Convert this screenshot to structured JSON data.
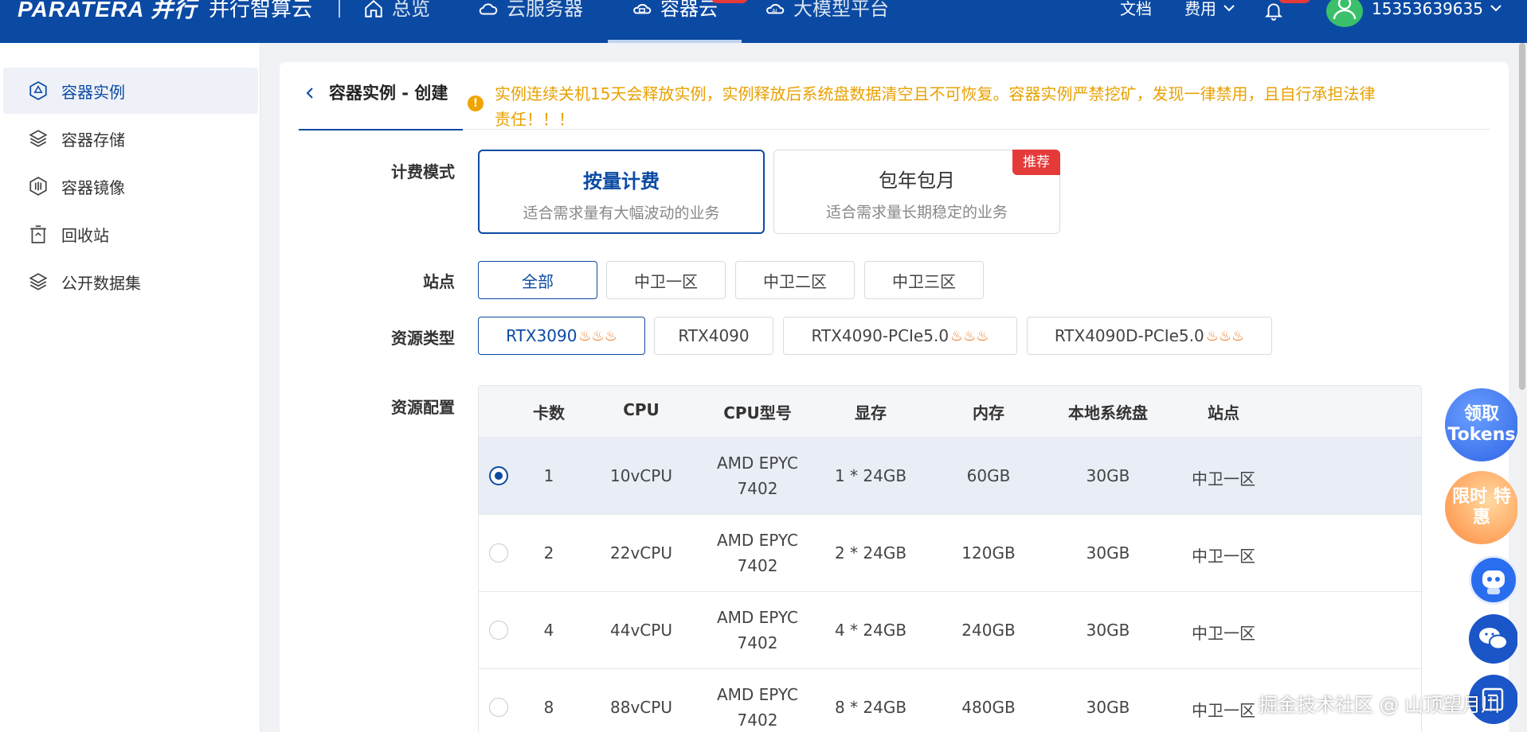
{
  "header": {
    "logo": "PARATERA 并行",
    "brand": "并行智算云",
    "nav": [
      {
        "label": "总览",
        "icon": "home-icon"
      },
      {
        "label": "云服务器",
        "icon": "cloud-icon"
      },
      {
        "label": "容器云",
        "icon": "container-icon",
        "active": true
      },
      {
        "label": "大模型平台",
        "icon": "ai-cloud-icon"
      }
    ],
    "docs": "文档",
    "fees": "费用",
    "user": "15353639635"
  },
  "sidebar": {
    "items": [
      {
        "label": "容器实例",
        "icon": "instance-icon",
        "active": true
      },
      {
        "label": "容器存储",
        "icon": "storage-icon"
      },
      {
        "label": "容器镜像",
        "icon": "image-icon"
      },
      {
        "label": "回收站",
        "icon": "trash-icon"
      },
      {
        "label": "公开数据集",
        "icon": "dataset-icon"
      }
    ]
  },
  "page": {
    "title": "容器实例 - 创建",
    "warning": "实例连续关机15天会释放实例，实例释放后系统盘数据清空且不可恢复。容器实例严禁挖矿，发现一律禁用，且自行承担法律责任！！！"
  },
  "billing": {
    "label": "计费模式",
    "options": [
      {
        "title": "按量计费",
        "desc": "适合需求量有大幅波动的业务",
        "selected": true
      },
      {
        "title": "包年包月",
        "desc": "适合需求量长期稳定的业务",
        "tag": "推荐"
      }
    ]
  },
  "site": {
    "label": "站点",
    "options": [
      "全部",
      "中卫一区",
      "中卫二区",
      "中卫三区"
    ],
    "selected": "全部"
  },
  "resource_type": {
    "label": "资源类型",
    "options": [
      "RTX3090",
      "RTX4090",
      "RTX4090-PCIe5.0",
      "RTX4090D-PCIe5.0"
    ],
    "selected": "RTX3090",
    "fire_icon": "flame-icon"
  },
  "resource_config": {
    "label": "资源配置",
    "columns": [
      "卡数",
      "CPU",
      "CPU型号",
      "显存",
      "内存",
      "本地系统盘",
      "站点"
    ],
    "rows": [
      {
        "cards": "1",
        "cpu": "10vCPU",
        "model_l1": "AMD EPYC",
        "model_l2": "7402",
        "vram": "1 * 24GB",
        "mem": "60GB",
        "disk": "30GB",
        "site": "中卫一区",
        "selected": true
      },
      {
        "cards": "2",
        "cpu": "22vCPU",
        "model_l1": "AMD EPYC",
        "model_l2": "7402",
        "vram": "2 * 24GB",
        "mem": "120GB",
        "disk": "30GB",
        "site": "中卫一区"
      },
      {
        "cards": "4",
        "cpu": "44vCPU",
        "model_l1": "AMD EPYC",
        "model_l2": "7402",
        "vram": "4 * 24GB",
        "mem": "240GB",
        "disk": "30GB",
        "site": "中卫一区"
      },
      {
        "cards": "8",
        "cpu": "88vCPU",
        "model_l1": "AMD EPYC",
        "model_l2": "7402",
        "vram": "8 * 24GB",
        "mem": "480GB",
        "disk": "30GB",
        "site": "中卫一区"
      }
    ]
  },
  "floating": {
    "tokens": "领取 Tokens",
    "promo": "限时 特惠"
  },
  "watermark": "掘金技术社区 @ 山顶望月川",
  "colors": {
    "primary": "#0b4aa3",
    "warning": "#e8a100",
    "danger": "#e53a3a"
  }
}
